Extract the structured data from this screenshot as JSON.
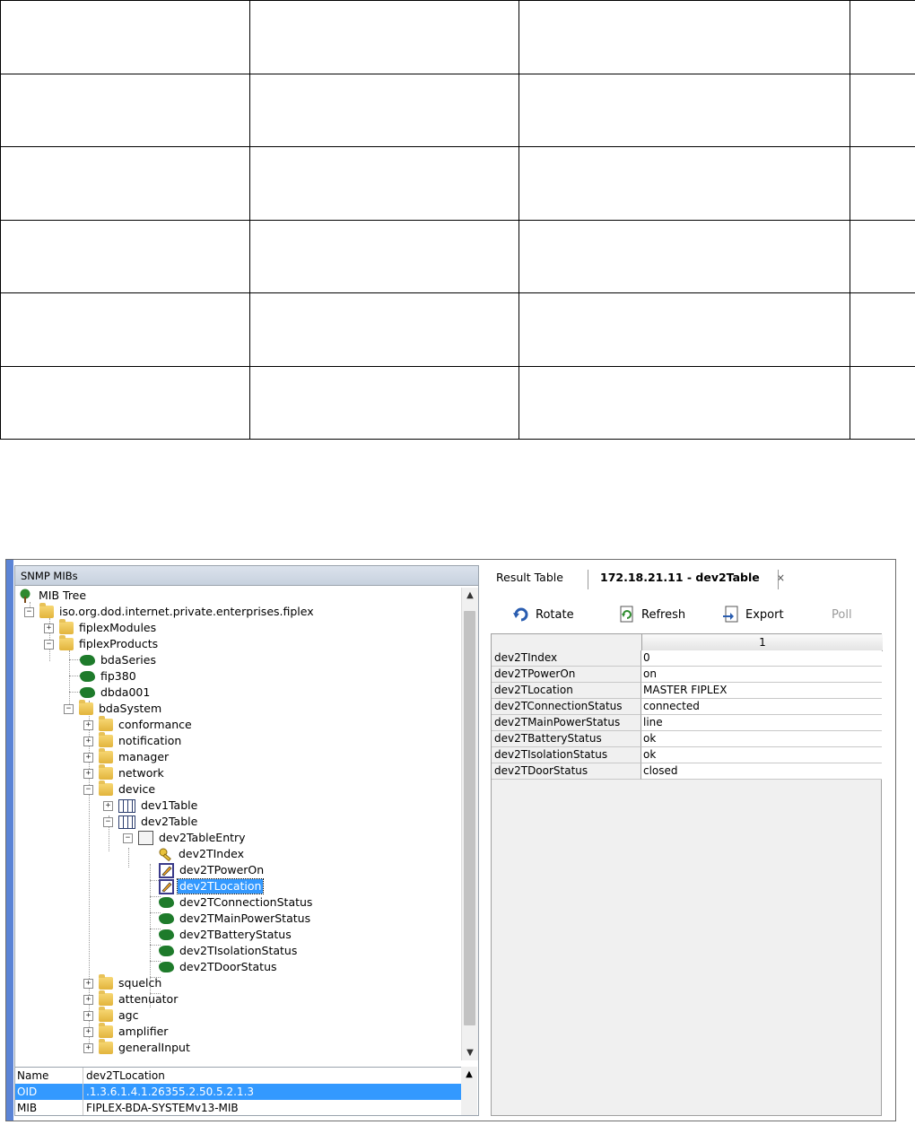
{
  "left_pane": {
    "header": "SNMP MIBs",
    "tree": [
      {
        "label": "MIB Tree",
        "icon": "mib-tree-icon"
      },
      {
        "label": "iso.org.dod.internet.private.enterprises.fiplex",
        "icon": "folder-icon",
        "expander": "−"
      },
      {
        "label": "fiplexModules",
        "icon": "folder-icon",
        "expander": "+"
      },
      {
        "label": "fiplexProducts",
        "icon": "folder-icon",
        "expander": "−"
      },
      {
        "label": "bdaSeries",
        "icon": "leaf-icon"
      },
      {
        "label": "fip380",
        "icon": "leaf-icon"
      },
      {
        "label": "dbda001",
        "icon": "leaf-icon"
      },
      {
        "label": "bdaSystem",
        "icon": "folder-icon",
        "expander": "−"
      },
      {
        "label": "conformance",
        "icon": "folder-icon",
        "expander": "+"
      },
      {
        "label": "notification",
        "icon": "folder-icon",
        "expander": "+"
      },
      {
        "label": "manager",
        "icon": "folder-icon",
        "expander": "+"
      },
      {
        "label": "network",
        "icon": "folder-icon",
        "expander": "+"
      },
      {
        "label": "device",
        "icon": "folder-icon",
        "expander": "−"
      },
      {
        "label": "dev1Table",
        "icon": "table-icon",
        "expander": "+"
      },
      {
        "label": "dev2Table",
        "icon": "table-icon",
        "expander": "−"
      },
      {
        "label": "dev2TableEntry",
        "icon": "table-entry-icon",
        "expander": "−"
      },
      {
        "label": "dev2TIndex",
        "icon": "key-icon"
      },
      {
        "label": "dev2TPowerOn",
        "icon": "writable-node-icon"
      },
      {
        "label": "dev2TLocation",
        "icon": "writable-node-icon",
        "selected": true
      },
      {
        "label": "dev2TConnectionStatus",
        "icon": "leaf-icon"
      },
      {
        "label": "dev2TMainPowerStatus",
        "icon": "leaf-icon"
      },
      {
        "label": "dev2TBatteryStatus",
        "icon": "leaf-icon"
      },
      {
        "label": "dev2TIsolationStatus",
        "icon": "leaf-icon"
      },
      {
        "label": "dev2TDoorStatus",
        "icon": "leaf-icon"
      },
      {
        "label": "squelch",
        "icon": "folder-icon",
        "expander": "+"
      },
      {
        "label": "attenuator",
        "icon": "folder-icon",
        "expander": "+"
      },
      {
        "label": "agc",
        "icon": "folder-icon",
        "expander": "+"
      },
      {
        "label": "amplifier",
        "icon": "folder-icon",
        "expander": "+"
      },
      {
        "label": "generalInput",
        "icon": "folder-icon",
        "expander": "+"
      }
    ],
    "properties": [
      {
        "key": "Name",
        "value": "dev2TLocation"
      },
      {
        "key": "OID",
        "value": ".1.3.6.1.4.1.26355.2.50.5.2.1.3",
        "selected": true
      },
      {
        "key": "MIB",
        "value": "FIPLEX-BDA-SYSTEMv13-MIB"
      }
    ]
  },
  "right_pane": {
    "tabs": [
      {
        "label": "Result Table"
      },
      {
        "label": "172.18.21.11 - dev2Table",
        "active": true,
        "close": "×"
      }
    ],
    "toolbar": {
      "rotate": "Rotate",
      "refresh": "Refresh",
      "export": "Export",
      "poll": "Poll"
    },
    "grid": {
      "column_header": "1",
      "rows": [
        {
          "key": "dev2TIndex",
          "value": "0"
        },
        {
          "key": "dev2TPowerOn",
          "value": "on"
        },
        {
          "key": "dev2TLocation",
          "value": "MASTER FIPLEX"
        },
        {
          "key": "dev2TConnectionStatus",
          "value": "connected"
        },
        {
          "key": "dev2TMainPowerStatus",
          "value": "line"
        },
        {
          "key": "dev2TBatteryStatus",
          "value": "ok"
        },
        {
          "key": "dev2TIsolationStatus",
          "value": "ok"
        },
        {
          "key": "dev2TDoorStatus",
          "value": "closed"
        }
      ]
    }
  },
  "colors": {
    "selection": "#3399ff",
    "accent": "#5b84d6",
    "leaf_green": "#1e7b2b",
    "folder_yellow": "#e2b43c"
  }
}
